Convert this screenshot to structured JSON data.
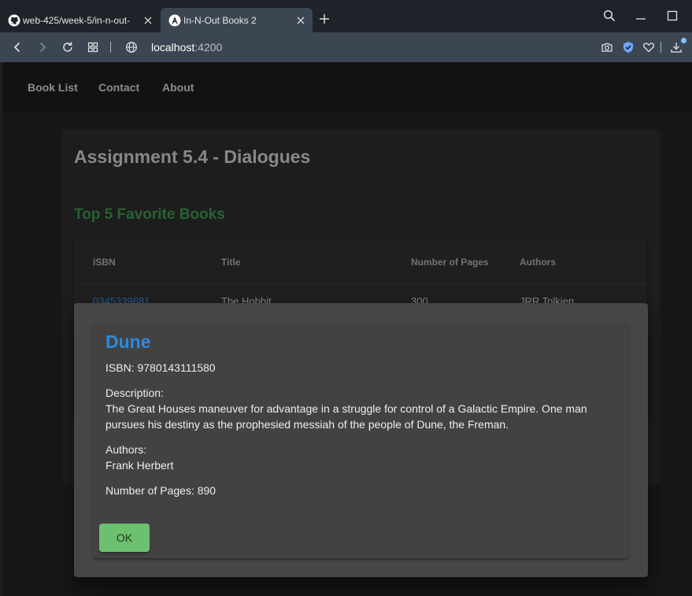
{
  "browser": {
    "tabs": [
      {
        "title": "web-425/week-5/in-n-out-",
        "favicon": "github-icon",
        "active": false
      },
      {
        "title": "In-N-Out Books 2",
        "favicon": "angular-icon",
        "active": true
      }
    ],
    "url": {
      "host": "localhost",
      "port": ":4200"
    }
  },
  "nav": {
    "items": [
      "Book List",
      "Contact",
      "About"
    ]
  },
  "card": {
    "title": "Assignment 5.4 - Dialogues",
    "subtitle": "Top 5 Favorite Books"
  },
  "table": {
    "headers": [
      "ISBN",
      "Title",
      "Number of Pages",
      "Authors"
    ],
    "rows": [
      {
        "isbn": "0345339681",
        "title": "The Hobbit",
        "pages": "300",
        "authors": "JRR Tolkien"
      }
    ]
  },
  "dialog": {
    "title": "Dune",
    "isbn": "ISBN: 9780143111580",
    "description_label": "Description:",
    "description": "The Great Houses maneuver for advantage in a struggle for control of a Galactic Empire. One man pursues his destiny as the prophesied messiah of the people of Dune, the Freman.",
    "authors_label": "Authors:",
    "authors": "Frank Herbert",
    "pages": "Number of Pages: 890",
    "ok_label": "OK"
  },
  "colors": {
    "accent_blue": "#2b8bdd",
    "heading_green": "#3f8f48",
    "ok_button": "#6cc06f"
  }
}
